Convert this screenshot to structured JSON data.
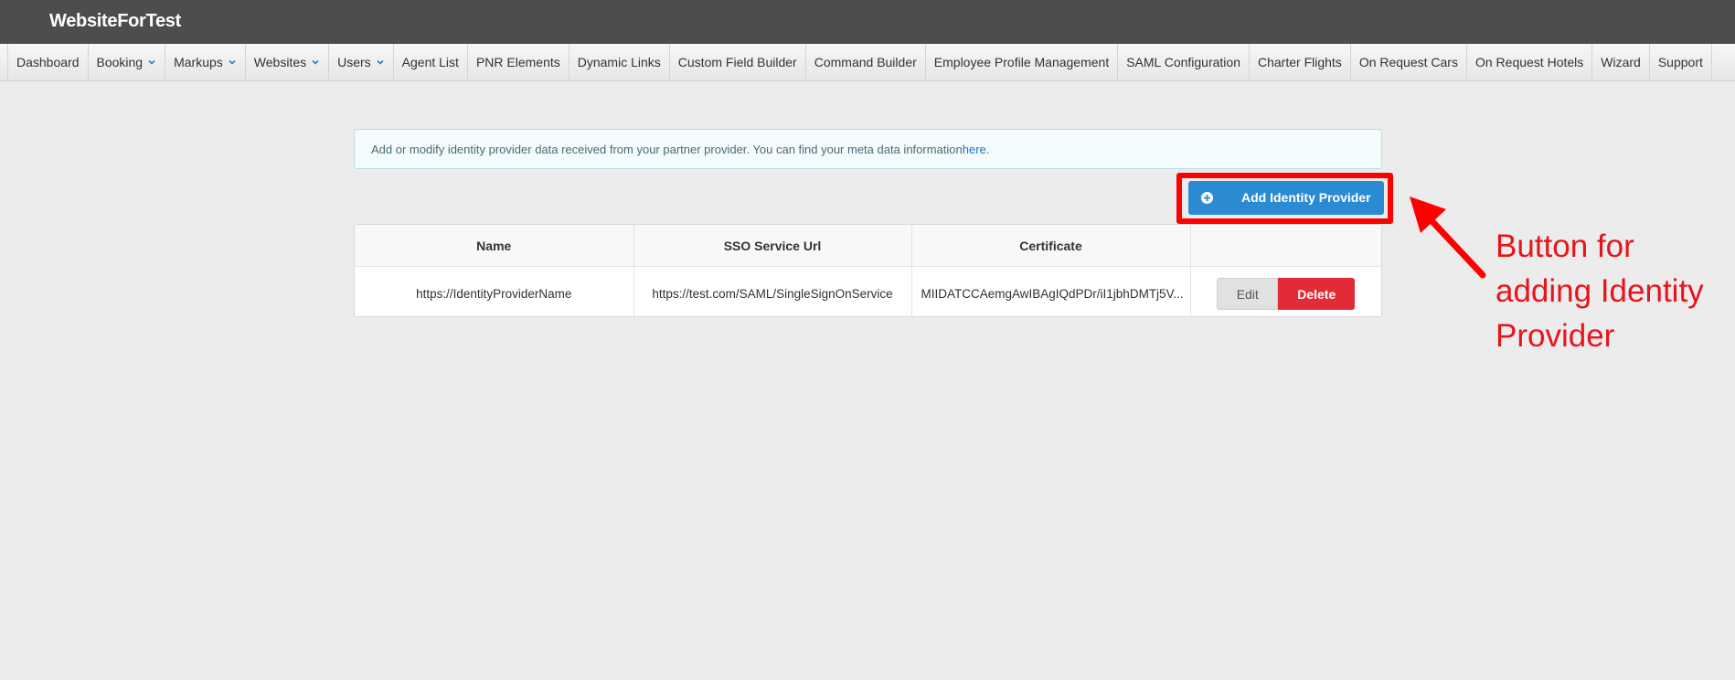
{
  "header": {
    "brand": "WebsiteForTest"
  },
  "nav": {
    "items": [
      {
        "label": "Dashboard"
      },
      {
        "label": "Booking",
        "dropdown": true
      },
      {
        "label": "Markups",
        "dropdown": true
      },
      {
        "label": "Websites",
        "dropdown": true
      },
      {
        "label": "Users",
        "dropdown": true
      },
      {
        "label": "Agent List"
      },
      {
        "label": "PNR Elements"
      },
      {
        "label": "Dynamic Links"
      },
      {
        "label": "Custom Field Builder"
      },
      {
        "label": "Command Builder"
      },
      {
        "label": "Employee Profile Management"
      },
      {
        "label": "SAML Configuration"
      },
      {
        "label": "Charter Flights"
      },
      {
        "label": "On Request Cars"
      },
      {
        "label": "On Request Hotels"
      },
      {
        "label": "Wizard"
      },
      {
        "label": "Support"
      }
    ]
  },
  "info": {
    "text": "Add or modify identity provider data received from your partner provider. You can find your meta data information ",
    "link": "here",
    "suffix": "."
  },
  "add_button": {
    "label": "Add Identity Provider",
    "icon": "plus-circle-icon"
  },
  "table": {
    "headers": [
      "Name",
      "SSO Service Url",
      "Certificate",
      ""
    ],
    "rows": [
      {
        "name": "https://IdentityProviderName",
        "sso_url": "https://test.com/SAML/SingleSignOnService",
        "certificate": "MIIDATCCAemgAwIBAgIQdPDr/iI1jbhDMTj5V...",
        "edit_label": "Edit",
        "delete_label": "Delete"
      }
    ]
  },
  "annotation": {
    "lines": [
      "Button for",
      "adding Identity",
      "Provider"
    ],
    "color": "#e8141c"
  },
  "colors": {
    "topbar": "#4d4d4d",
    "primary": "#2a8bd2",
    "danger": "#e22b36",
    "highlight": "#ff0000"
  }
}
